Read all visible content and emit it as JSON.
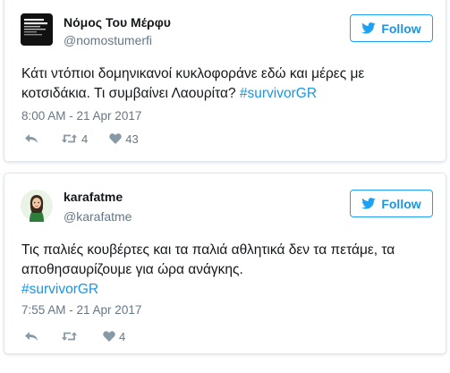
{
  "colors": {
    "accent": "#1da1f2",
    "link": "#1b95e0",
    "secondary_text": "#657786",
    "border": "#e1e8ed"
  },
  "tweets": [
    {
      "author_name": "Νόμος Του Μέρφυ",
      "handle": "@nomostumerfi",
      "avatar_text": "COGNITIVE DISSONANCE",
      "follow_label": "Follow",
      "text_lines": [
        "Κάτι ντόπιοι δομηνικανοί κυκλοφοράνε εδώ και μέρες με"
      ],
      "text_last_plain": "κοτσιδάκια. Τι συμβαίνει Λαουρίτα? ",
      "hashtag": "#survivorGR",
      "timestamp": "8:00 AM - 21 Apr 2017",
      "retweets": "4",
      "likes": "43",
      "icons": [
        "twitter-bird-icon",
        "reply-icon",
        "retweet-icon",
        "heart-icon"
      ]
    },
    {
      "author_name": "karafatme",
      "handle": "@karafatme",
      "follow_label": "Follow",
      "text_lines": [
        "Τις παλιές κουβέρτες και τα παλιά αθλητικά δεν τα πετάμε, τα",
        "αποθησαυρίζουμε για ώρα ανάγκης."
      ],
      "hashtag": "#survivorGR",
      "timestamp": "7:55 AM - 21 Apr 2017",
      "retweets": "",
      "likes": "4",
      "icons": [
        "twitter-bird-icon",
        "reply-icon",
        "retweet-icon",
        "heart-icon"
      ]
    }
  ]
}
